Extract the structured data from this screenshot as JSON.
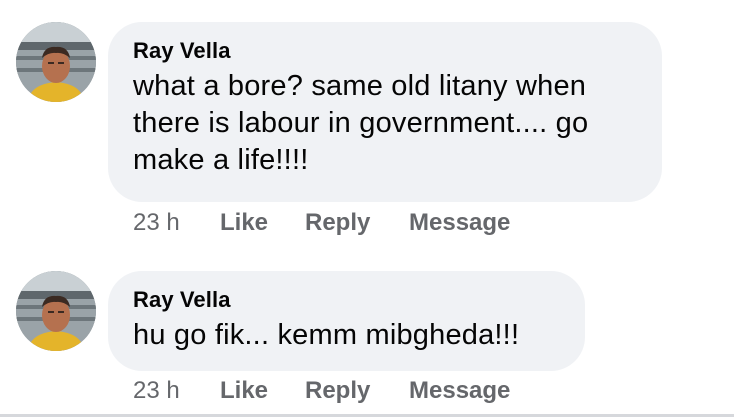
{
  "comments": [
    {
      "author": "Ray Vella",
      "text": "what a bore? same old litany when there is labour in government.... go make a life!!!!",
      "time": "23 h",
      "like": "Like",
      "reply": "Reply",
      "message": "Message"
    },
    {
      "author": "Ray Vella",
      "text": "hu go fik... kemm mibgheda!!!",
      "time": "23 h",
      "like": "Like",
      "reply": "Reply",
      "message": "Message"
    }
  ],
  "icons": {
    "avatar": "profile-photo-icon"
  },
  "colors": {
    "bubble": "#f0f2f5",
    "author": "#050505",
    "meta": "#65676b"
  }
}
